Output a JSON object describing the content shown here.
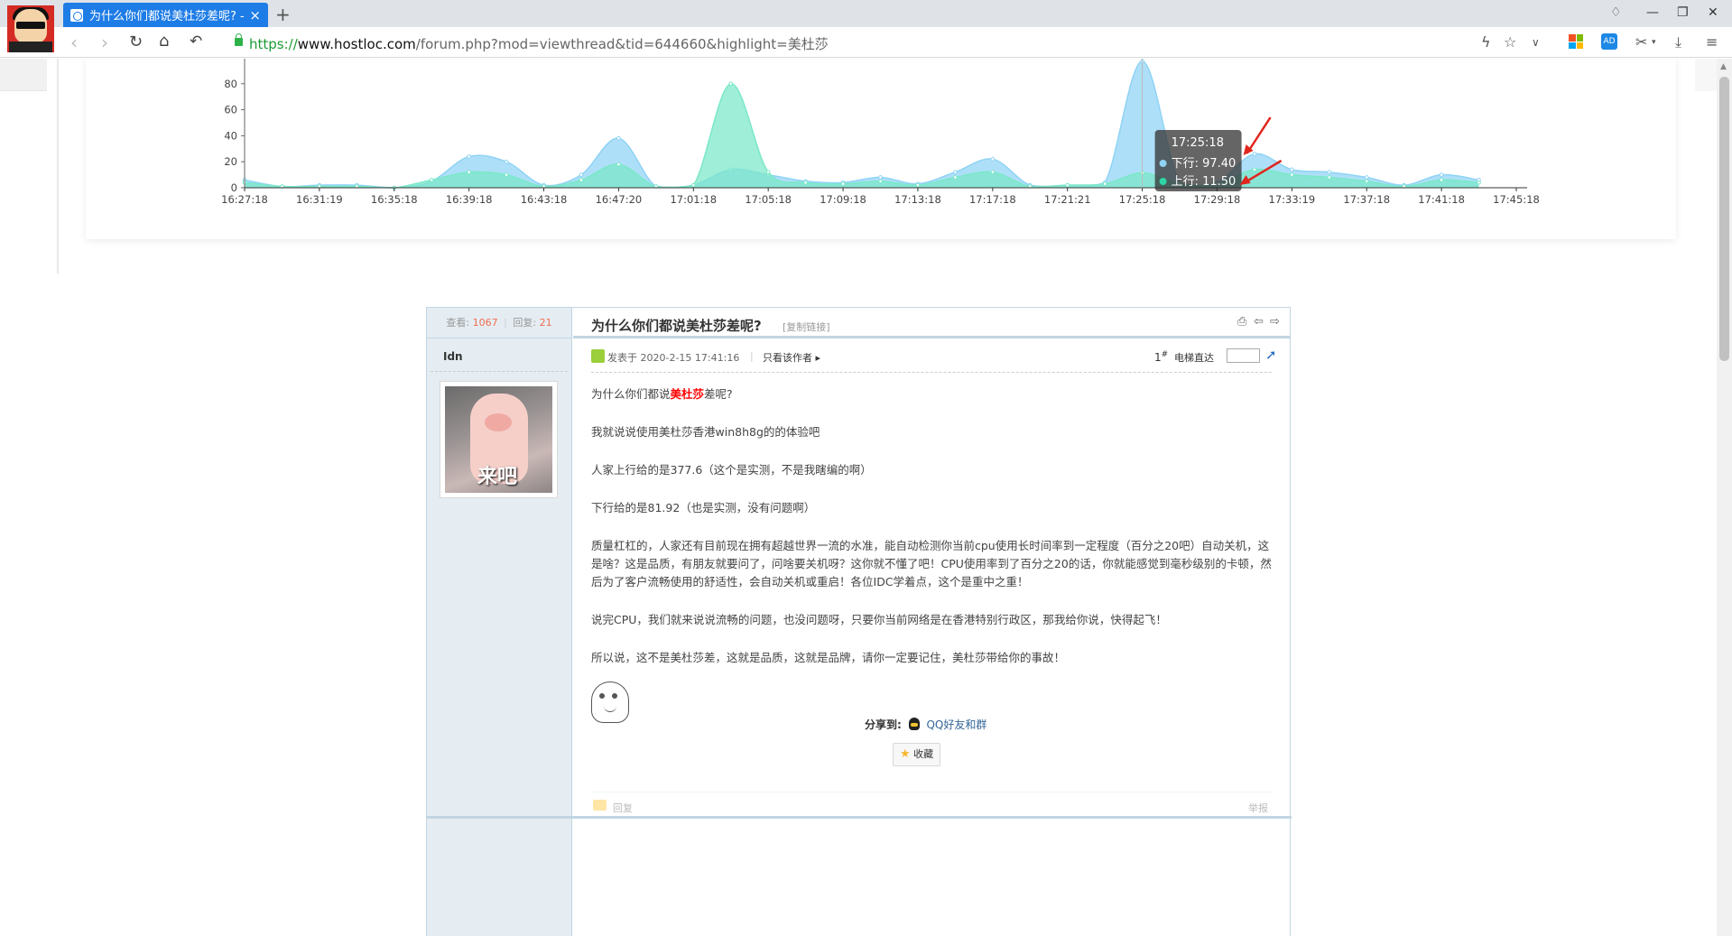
{
  "browser": {
    "tab_title": "为什么你们都说美杜莎差呢? - 全",
    "tab_close": "×",
    "new_tab": "+",
    "url_scheme": "https://",
    "url_host": "www.hostloc.com",
    "url_path": "/forum.php?mod=viewthread&tid=644660&highlight=美杜莎"
  },
  "chart_data": {
    "type": "area",
    "title": "",
    "x": [
      "16:27:18",
      "16:31:19",
      "16:35:18",
      "16:39:18",
      "16:43:18",
      "16:47:20",
      "17:01:18",
      "17:05:18",
      "17:09:18",
      "17:13:18",
      "17:17:18",
      "17:21:21",
      "17:25:18",
      "17:29:18",
      "17:33:19",
      "17:37:18",
      "17:41:18",
      "17:45:18"
    ],
    "ylim": [
      0,
      80
    ],
    "yticks": [
      0,
      20,
      40,
      60,
      80
    ],
    "series": [
      {
        "name": "下行",
        "color": "#8fd3f5",
        "points": [
          [
            0,
            6
          ],
          [
            0.5,
            1
          ],
          [
            1,
            2
          ],
          [
            1.5,
            2
          ],
          [
            2,
            0
          ],
          [
            2.5,
            5
          ],
          [
            3,
            24
          ],
          [
            3.5,
            20
          ],
          [
            4,
            2
          ],
          [
            4.5,
            10
          ],
          [
            5,
            38
          ],
          [
            5.5,
            1
          ],
          [
            6,
            2
          ],
          [
            6.5,
            14
          ],
          [
            7,
            10
          ],
          [
            7.5,
            5
          ],
          [
            8,
            4
          ],
          [
            8.5,
            8
          ],
          [
            9,
            3
          ],
          [
            9.5,
            12
          ],
          [
            10,
            22
          ],
          [
            10.5,
            2
          ],
          [
            11,
            2
          ],
          [
            11.5,
            4
          ],
          [
            12,
            97.4
          ],
          [
            12.5,
            4
          ],
          [
            13,
            4
          ],
          [
            13.5,
            26
          ],
          [
            14,
            14
          ],
          [
            14.5,
            12
          ],
          [
            15,
            8
          ],
          [
            15.5,
            2
          ],
          [
            16,
            10
          ],
          [
            16.5,
            6
          ]
        ]
      },
      {
        "name": "上行",
        "color": "#7ae8c8",
        "points": [
          [
            0,
            4
          ],
          [
            0.5,
            1
          ],
          [
            1,
            1
          ],
          [
            1.5,
            1
          ],
          [
            2,
            0
          ],
          [
            2.5,
            6
          ],
          [
            3,
            12
          ],
          [
            3.5,
            10
          ],
          [
            4,
            1
          ],
          [
            4.5,
            6
          ],
          [
            5,
            18
          ],
          [
            5.5,
            1
          ],
          [
            6,
            2
          ],
          [
            6.5,
            80
          ],
          [
            7,
            12
          ],
          [
            7.5,
            4
          ],
          [
            8,
            3
          ],
          [
            8.5,
            5
          ],
          [
            9,
            2
          ],
          [
            9.5,
            8
          ],
          [
            10,
            12
          ],
          [
            10.5,
            1
          ],
          [
            11,
            2
          ],
          [
            11.5,
            3
          ],
          [
            12,
            11.5
          ],
          [
            12.5,
            3
          ],
          [
            13,
            3
          ],
          [
            13.5,
            14
          ],
          [
            14,
            10
          ],
          [
            14.5,
            8
          ],
          [
            15,
            5
          ],
          [
            15.5,
            1
          ],
          [
            16,
            6
          ],
          [
            16.5,
            4
          ]
        ]
      }
    ],
    "tooltip": {
      "time": "17:25:18",
      "down": "下行: 97.40",
      "up": "上行: 11.50"
    }
  },
  "post": {
    "stats_views_label": "查看:",
    "stats_views": "1067",
    "stats_sep": "|",
    "stats_replies_label": "回复:",
    "stats_replies": "21",
    "author": "Idn",
    "avatar_text": "来吧",
    "title": "为什么你们都说美杜莎差呢?",
    "copy_link": "[复制链接]",
    "date": "发表于 2020-2-15 17:41:16",
    "meta_sep": "|",
    "only_author": "只看该作者",
    "floor": "1",
    "floor_sup": "#",
    "jump_label": "电梯直达",
    "content": {
      "line1_pre": "为什么你们都说",
      "line1_hl": "美杜莎",
      "line1_post": "差呢?",
      "p2": "我就说说使用美杜莎香港win8h8g的的体验吧",
      "p3": "人家上行给的是377.6（这个是实测，不是我瞎编的啊）",
      "p4": "下行给的是81.92（也是实测，没有问题啊）",
      "p5": "质量杠杠的，人家还有目前现在拥有超越世界一流的水准，能自动检测你当前cpu使用长时间率到一定程度（百分之20吧）自动关机，这是啥？这是品质，有朋友就要问了，问啥要关机呀？这你就不懂了吧！CPU使用率到了百分之20的话，你就能感觉到毫秒级别的卡顿，然后为了客户流畅使用的舒适性，会自动关机或重启！各位IDC学着点，这个是重中之重！",
      "p6": "说完CPU，我们就来说说流畅的问题，也没问题呀，只要你当前网络是在香港特别行政区，那我给你说，快得起飞！",
      "p7": "所以说，这不是美杜莎差，这就是品质，这就是品牌，请你一定要记住，美杜莎带给你的事故！"
    },
    "share_label": "分享到:",
    "share_link": "QQ好友和群",
    "fav_label": "收藏",
    "reply_label": "回复",
    "report_label": "举报"
  }
}
